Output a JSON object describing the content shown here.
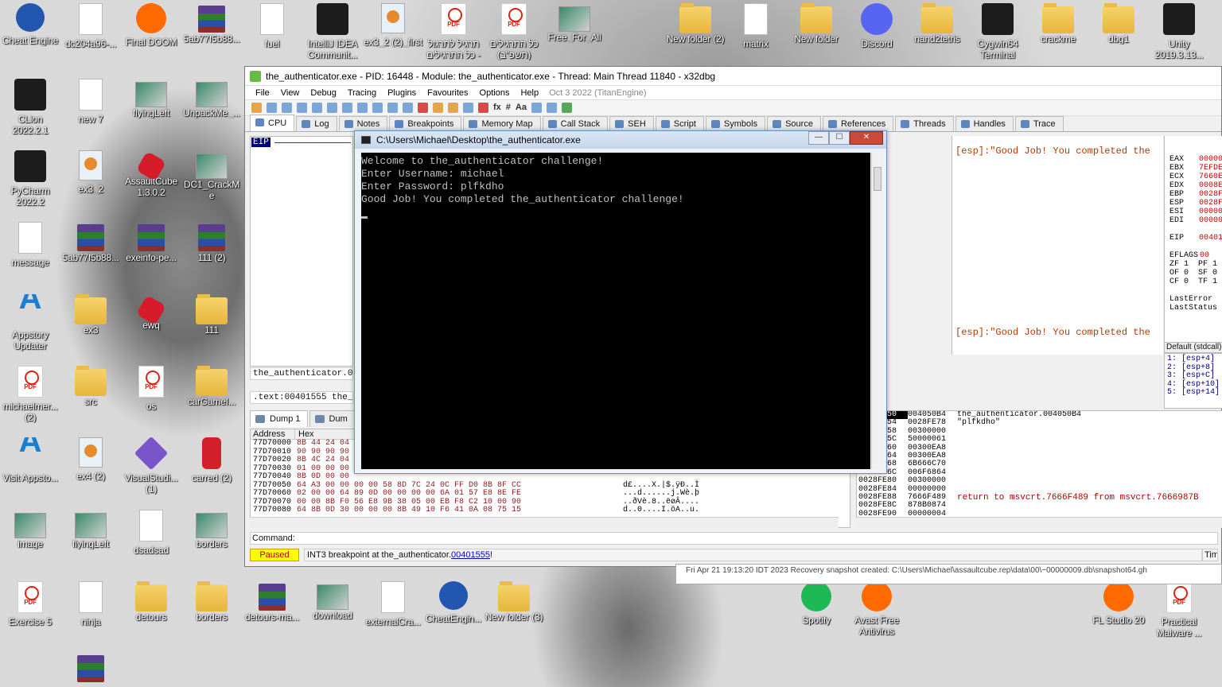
{
  "desktop": {
    "icons": [
      {
        "label": "Cheat Engine",
        "icon": "gear-icon"
      },
      {
        "label": "dc204a96-...",
        "icon": "doc-icon"
      },
      {
        "label": "Final DOOM",
        "icon": "doom-icon"
      },
      {
        "label": "5ab77f5b88...",
        "icon": "rar-icon"
      },
      {
        "label": "fuel",
        "icon": "doc-icon"
      },
      {
        "label": "IntelliJ IDEA Communit...",
        "icon": "intellij-icon"
      },
      {
        "label": "ex3_2 (2)_first",
        "icon": "java-icon"
      },
      {
        "label": "תרגיל לתרגול כל התרגילים - ...",
        "icon": "pdf-icon"
      },
      {
        "label": "כל התרגילים (תשפ\"ב)",
        "icon": "pdf-icon"
      },
      {
        "label": "Free_For_All",
        "icon": "image-icon"
      },
      {
        "label": "New folder (2)",
        "icon": "folder-icon"
      },
      {
        "label": "matrix",
        "icon": "doc-icon"
      },
      {
        "label": "New folder",
        "icon": "folder-icon"
      },
      {
        "label": "Discord",
        "icon": "discord-icon"
      },
      {
        "label": "nand2tetris",
        "icon": "folder-icon"
      },
      {
        "label": "Cygwin64 Terminal",
        "icon": "terminal-icon"
      },
      {
        "label": "crackme",
        "icon": "folder-icon"
      },
      {
        "label": "dbg1",
        "icon": "folder-icon"
      },
      {
        "label": "Unity 2019.3.13...",
        "icon": "unity-icon"
      },
      {
        "label": "CLion 2022.2.1",
        "icon": "clion-icon"
      },
      {
        "label": "new 7",
        "icon": "doc-icon"
      },
      {
        "label": "flyingLeft",
        "icon": "image-icon"
      },
      {
        "label": "UnpackMe_...",
        "icon": "image-icon"
      },
      {
        "label": "PyCharm 2022.2",
        "icon": "pycharm-icon"
      },
      {
        "label": "ex3_2",
        "icon": "java-icon"
      },
      {
        "label": "AssaultCube 1.3.0.2",
        "icon": "assaultcube-icon"
      },
      {
        "label": "DC1_CrackMe",
        "icon": "image-icon"
      },
      {
        "label": "message",
        "icon": "doc-icon"
      },
      {
        "label": "5ab77f5b88...",
        "icon": "rar-icon"
      },
      {
        "label": "exeinfo-pe...",
        "icon": "rar-icon"
      },
      {
        "label": "111 (2)",
        "icon": "rar-icon"
      },
      {
        "label": "Appstory Updater",
        "icon": "appstory-icon"
      },
      {
        "label": "ex3",
        "icon": "folder-icon"
      },
      {
        "label": "ewq",
        "icon": "hex-icon"
      },
      {
        "label": "111",
        "icon": "folder-icon"
      },
      {
        "label": "michaelmer... (2)",
        "icon": "pdf-icon"
      },
      {
        "label": "src",
        "icon": "folder-icon"
      },
      {
        "label": "os",
        "icon": "pdf-icon"
      },
      {
        "label": "carGameI...",
        "icon": "folder-icon"
      },
      {
        "label": "Visit Appsto...",
        "icon": "appstory-icon"
      },
      {
        "label": "ex4 (2)",
        "icon": "java-icon"
      },
      {
        "label": "VisualStudi... (1)",
        "icon": "vs-icon"
      },
      {
        "label": "carred (2)",
        "icon": "car-icon"
      },
      {
        "label": "image",
        "icon": "image-icon"
      },
      {
        "label": "flyingLeft",
        "icon": "image-icon"
      },
      {
        "label": "dsadsad",
        "icon": "doc-icon"
      },
      {
        "label": "borders",
        "icon": "image-icon"
      },
      {
        "label": "Exercise 5",
        "icon": "pdf-icon"
      },
      {
        "label": "ninja",
        "icon": "doc-icon"
      },
      {
        "label": "detours",
        "icon": "folder-icon"
      },
      {
        "label": "borders",
        "icon": "folder-icon"
      },
      {
        "label": "detours-ma...",
        "icon": "rar-icon"
      },
      {
        "label": "download",
        "icon": "image-icon"
      },
      {
        "label": "externalCra...",
        "icon": "doc-icon"
      },
      {
        "label": "CheatEngin...",
        "icon": "gear-icon"
      },
      {
        "label": "New folder (3)",
        "icon": "folder-icon"
      },
      {
        "label": "Spotify",
        "icon": "spotify-icon"
      },
      {
        "label": "Avast Free Antivirus",
        "icon": "avast-icon"
      },
      {
        "label": "FL Studio 20",
        "icon": "flstudio-icon"
      },
      {
        "label": "Practical Malware ...",
        "icon": "pdf-icon"
      },
      {
        "label": "",
        "icon": "rar-icon"
      }
    ]
  },
  "debugger": {
    "title": "the_authenticator.exe - PID: 16448 - Module: the_authenticator.exe - Thread: Main Thread 11840 - x32dbg",
    "menu": [
      "File",
      "View",
      "Debug",
      "Tracing",
      "Plugins",
      "Favourites",
      "Options",
      "Help"
    ],
    "menu_date": "Oct 3 2022 (TitanEngine)",
    "tabs": [
      "CPU",
      "Log",
      "Notes",
      "Breakpoints",
      "Memory Map",
      "Call Stack",
      "SEH",
      "Script",
      "Symbols",
      "Source",
      "References",
      "Threads",
      "Handles",
      "Trace"
    ],
    "eip_label": "EIP",
    "info_line1": "the_authenticator.00",
    "info_line2": ".text:00401555 the_a",
    "dump_tabs": [
      "Dump 1",
      "Dum"
    ],
    "dump_headers": [
      "Address",
      "Hex"
    ],
    "dump_rows": [
      {
        "addr": "77D70000",
        "hex": "8B 44 24 04 ",
        "text": ""
      },
      {
        "addr": "77D70010",
        "hex": "90 90 90 90 ",
        "text": ""
      },
      {
        "addr": "77D70020",
        "hex": "8B 4C 24 04 ",
        "text": ""
      },
      {
        "addr": "77D70030",
        "hex": "01 00 00 00 ",
        "text": ""
      },
      {
        "addr": "77D70040",
        "hex": "8B 0D 00 00 ",
        "text": ""
      },
      {
        "addr": "77D70050",
        "hex": "64 A3 00 00 00 00 58 8D 7C 24 0C FF D0 8B 8F CC",
        "text": "d£....X.|$.ÿÐ..Ì"
      },
      {
        "addr": "77D70060",
        "hex": "02 00 00 64 89 0D 00 00 00 00 6A 01 57 E8 8E FE",
        "text": "...d......j.Wè.þ"
      },
      {
        "addr": "77D70070",
        "hex": "00 00 8B F0 56 E8 9B 38 05 00 EB F8 C2 10 00 90",
        "text": "..ðVè.8..ëøÂ...."
      },
      {
        "addr": "77D70080",
        "hex": "64 8B 0D 30 00 00 00 8B 49 10 F6 41 0A 08 75 15",
        "text": "d..0....I.öA..u."
      }
    ],
    "esp_comment": "[esp]:\"Good Job! You completed the",
    "registers": [
      {
        "name": "EAX",
        "value": "00000"
      },
      {
        "name": "EBX",
        "value": "7EFDE"
      },
      {
        "name": "ECX",
        "value": "7660E"
      },
      {
        "name": "EDX",
        "value": "0008E"
      },
      {
        "name": "EBP",
        "value": "0028F"
      },
      {
        "name": "ESP",
        "value": "0028F"
      },
      {
        "name": "ESI",
        "value": "00000"
      },
      {
        "name": "EDI",
        "value": "00000"
      },
      {
        "name": "EIP",
        "value": "00401"
      }
    ],
    "eflags_label": "EFLAGS",
    "eflags_value": "00",
    "flags": [
      "ZF 1  PF 1",
      "OF 0  SF 0",
      "CF 0  TF 1"
    ],
    "last_error": "LastError",
    "last_status": "LastStatus",
    "call_convention": "Default (stdcall)",
    "args": [
      "1: [esp+4]",
      "2: [esp+8]",
      "3: [esp+C]",
      "4: [esp+10]",
      "5: [esp+14]"
    ],
    "stack_rows": [
      {
        "addr": "0028FE50",
        "val": "004050B4",
        "comment": "the_authenticator.004050B4",
        "hl": true
      },
      {
        "addr": "0028FE54",
        "val": "0028FE78",
        "comment": "\"plfkdho\""
      },
      {
        "addr": "0028FE58",
        "val": "00300000",
        "comment": ""
      },
      {
        "addr": "0028FE5C",
        "val": "50000061",
        "comment": ""
      },
      {
        "addr": "0028FE60",
        "val": "00300EA8",
        "comment": ""
      },
      {
        "addr": "0028FE64",
        "val": "00300EA8",
        "comment": ""
      },
      {
        "addr": "0028FE68",
        "val": "6B666C70",
        "comment": ""
      },
      {
        "addr": "0028FE6C",
        "val": "006F6864",
        "comment": ""
      },
      {
        "addr": "0028FE80",
        "val": "00300000",
        "comment": ""
      },
      {
        "addr": "0028FE84",
        "val": "00000000",
        "comment": ""
      },
      {
        "addr": "0028FE88",
        "val": "7666F489",
        "comment": "return to msvcrt.7666F489 from msvcrt.7666987B",
        "red": true
      },
      {
        "addr": "0028FE8C",
        "val": "878B0874",
        "comment": ""
      },
      {
        "addr": "0028FE90",
        "val": "00000004",
        "comment": ""
      }
    ],
    "command_label": "Command:",
    "status": "Paused",
    "status_msg_prefix": "INT3 breakpoint at the_authenticator.",
    "status_msg_link": "00401555",
    "status_msg_suffix": "!",
    "status_time": "Tim"
  },
  "console": {
    "title": "C:\\Users\\Michael\\Desktop\\the_authenticator.exe",
    "lines": [
      "Welcome to the_authenticator challenge!",
      "Enter Username: michael",
      "Enter Password: plfkdho",
      "Good Job! You completed the_authenticator challenge!"
    ],
    "buttons": {
      "minimize": "—",
      "maximize": "☐",
      "close": "✕"
    }
  },
  "log_strip": "Fri Apr 21 19:13:20 IDT 2023 Recovery snapshot created: C:\\Users\\Michael\\assaultcube.rep\\data\\00\\~00000009.db\\snapshot64.gh"
}
